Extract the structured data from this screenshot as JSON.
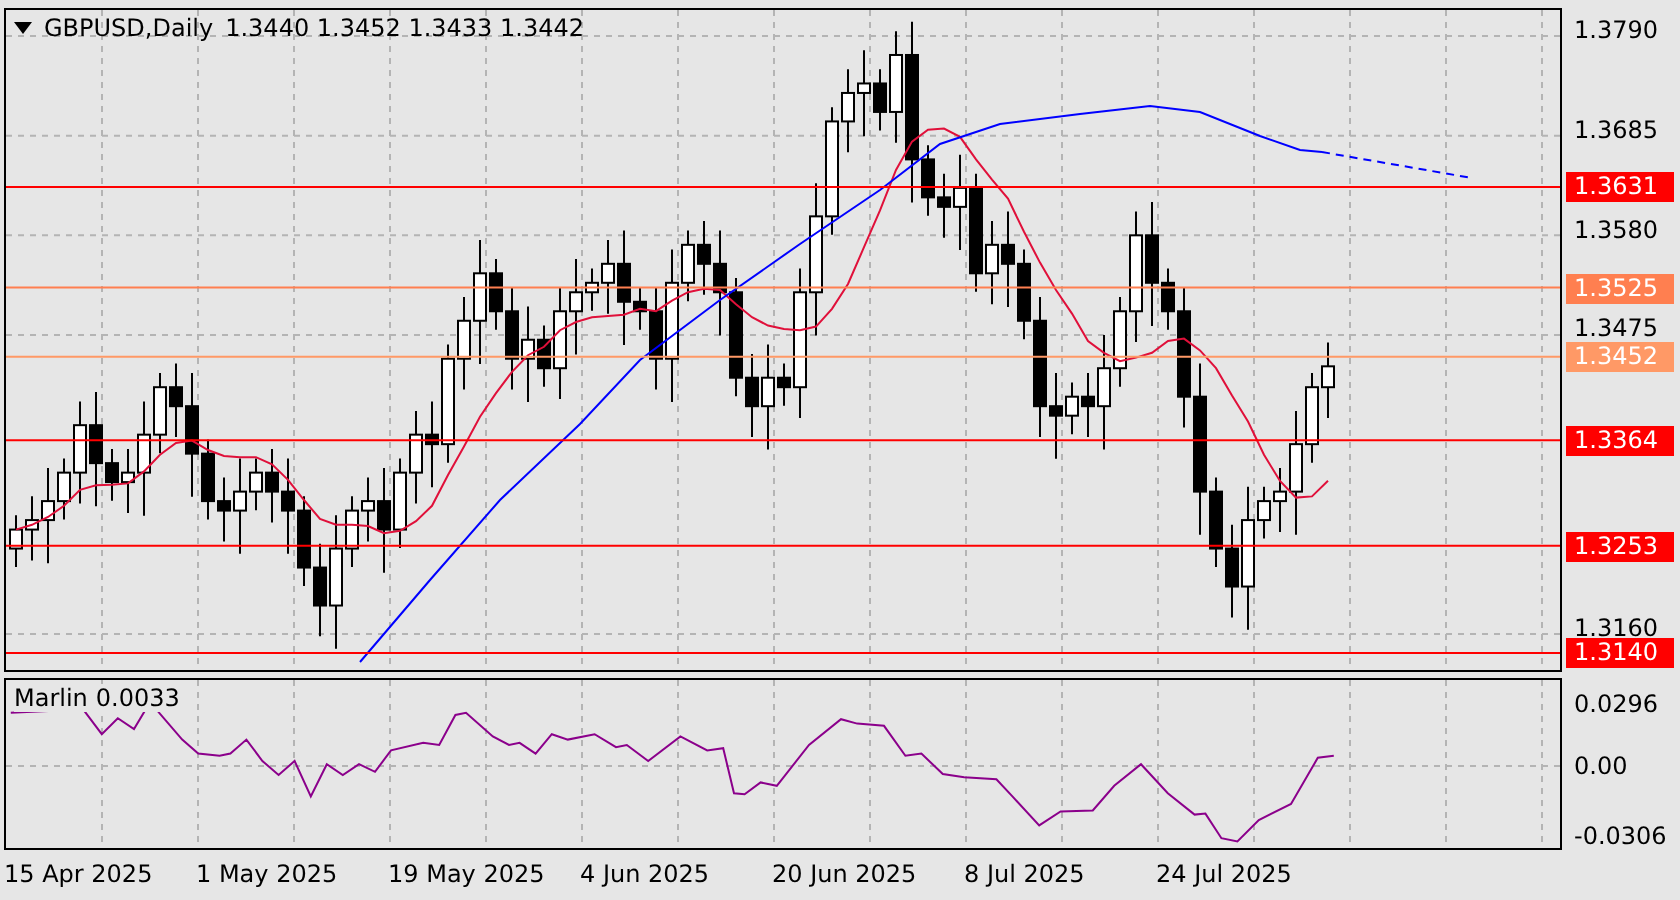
{
  "header": {
    "symbol": "GBPUSD,Daily",
    "ohlc": "1.3440 1.3452 1.3433 1.3442"
  },
  "price_axis": {
    "ticks": [
      "1.3790",
      "1.3685",
      "1.3580",
      "1.3475",
      "1.3160"
    ]
  },
  "levels": [
    {
      "label": "1.3631",
      "color": "#ff0000"
    },
    {
      "label": "1.3525",
      "color": "#ff7f50"
    },
    {
      "label": "1.3452",
      "color": "#ff9966"
    },
    {
      "label": "1.3364",
      "color": "#ff0000"
    },
    {
      "label": "1.3253",
      "color": "#ff0000"
    },
    {
      "label": "1.3140",
      "color": "#ff0000"
    }
  ],
  "indicator": {
    "name": "Marlin",
    "value": "0.0033",
    "ticks": [
      "0.0296",
      "0.00",
      "-0.0306"
    ]
  },
  "date_axis": [
    "15 Apr 2025",
    "1 May 2025",
    "19 May 2025",
    "4 Jun 2025",
    "20 Jun 2025",
    "8 Jul 2025",
    "24 Jul 2025"
  ]
}
